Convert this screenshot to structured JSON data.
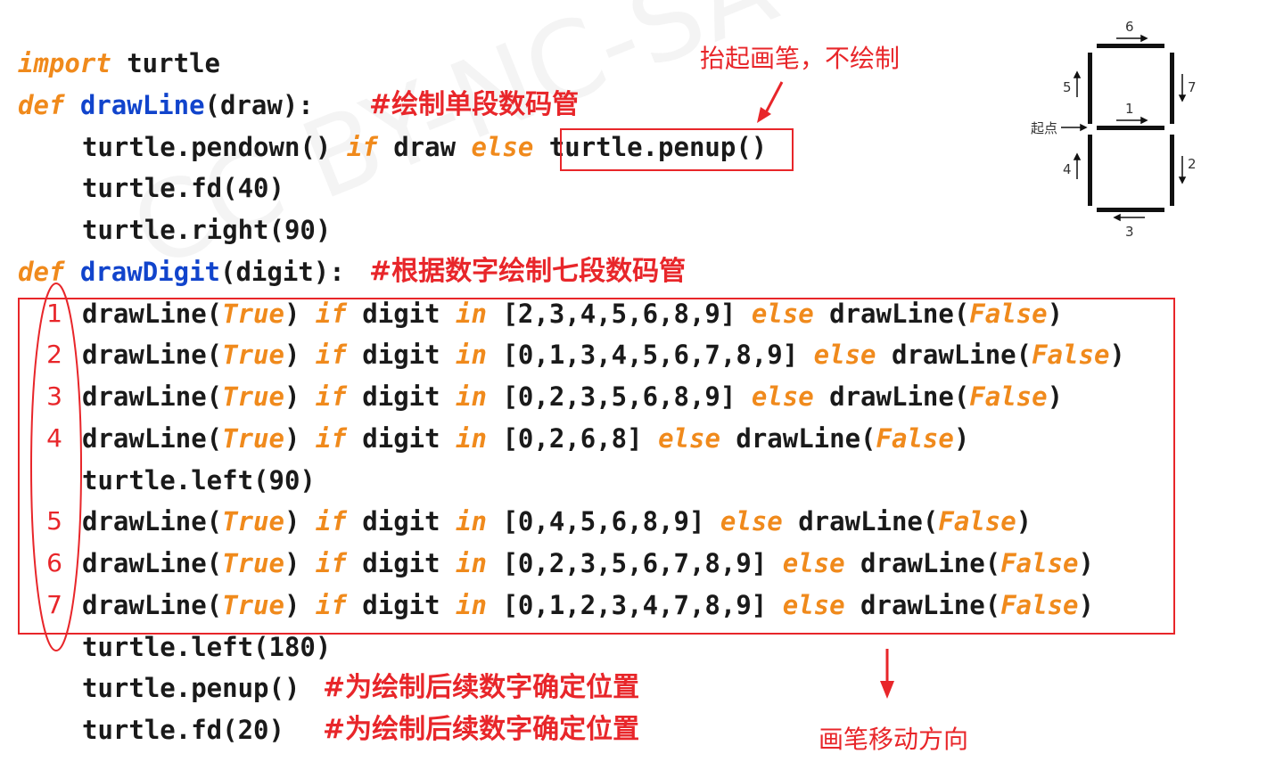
{
  "annotations": {
    "penup_note": "抬起画笔，不绘制",
    "move_direction": "画笔移动方向"
  },
  "code": {
    "l1": {
      "kw": "import",
      "rest": " turtle"
    },
    "l2": {
      "kw": "def",
      "fn": "drawLine",
      "rest": "(draw):",
      "comment": "#绘制单段数码管"
    },
    "l3": {
      "a": "turtle.pendown() ",
      "kw1": "if",
      "b": " draw ",
      "kw2": "else",
      "c": " turtle.penup()"
    },
    "l4": "turtle.fd(40)",
    "l5": "turtle.right(90)",
    "l6": {
      "kw": "def",
      "fn": "drawDigit",
      "rest": "(digit):",
      "comment": "#根据数字绘制七段数码管"
    },
    "segments": [
      {
        "num": "1",
        "list": "[2,3,4,5,6,8,9]"
      },
      {
        "num": "2",
        "list": "[0,1,3,4,5,6,7,8,9]"
      },
      {
        "num": "3",
        "list": "[0,2,3,5,6,8,9]"
      },
      {
        "num": "4",
        "list": "[0,2,6,8]"
      },
      {
        "num": "5",
        "list": "[0,4,5,6,8,9]"
      },
      {
        "num": "6",
        "list": "[0,2,3,5,6,7,8,9]"
      },
      {
        "num": "7",
        "list": "[0,1,2,3,4,7,8,9]"
      }
    ],
    "tokens": {
      "call": "drawLine(",
      "true": "True",
      "close": ")",
      "if": "if",
      "digit": " digit ",
      "in": "in",
      "else": "else",
      "false": "False"
    },
    "left90": "turtle.left(90)",
    "left180": "turtle.left(180)",
    "penup": "turtle.penup()",
    "fd20": "turtle.fd(20)",
    "pos_comment": "#为绘制后续数字确定位置"
  },
  "diagram": {
    "start_label": "起点",
    "labels": [
      "1",
      "2",
      "3",
      "4",
      "5",
      "6",
      "7"
    ]
  },
  "colors": {
    "accent_red": "#e8262a",
    "keyword_orange": "#f08a1c",
    "function_blue": "#1144cc"
  }
}
